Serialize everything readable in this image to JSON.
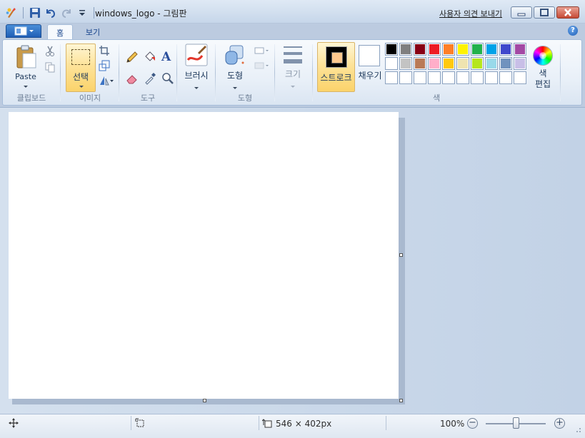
{
  "window": {
    "title": "windows_logo - 그림판",
    "feedback_link": "사용자 의견 보내기"
  },
  "quick_access": {
    "items": [
      "save-icon",
      "undo-icon",
      "redo-icon",
      "customize-icon"
    ]
  },
  "tabs": [
    {
      "label": "홈",
      "selected": true
    },
    {
      "label": "보기",
      "selected": false
    }
  ],
  "ribbon": {
    "clipboard": {
      "paste_label": "Paste",
      "group_label": "클립보드"
    },
    "image": {
      "select_label": "선택",
      "group_label": "이미지"
    },
    "tools": {
      "group_label": "도구"
    },
    "brushes": {
      "label": "브러시"
    },
    "shapes": {
      "label": "도형",
      "group_label": "도형"
    },
    "size": {
      "label": "크기"
    },
    "colors": {
      "stroke_label": "스트로크",
      "fill_label": "채우기",
      "edit_label_1": "색",
      "edit_label_2": "편집",
      "group_label": "색",
      "stroke_color": "#000000",
      "stroke_inner_color": "#ffc98e",
      "fill_color": "#ffffff",
      "palette_row1": [
        "#000000",
        "#7f7f7f",
        "#880015",
        "#ed1c24",
        "#ff7f27",
        "#fff200",
        "#22b14c",
        "#00a2e8",
        "#3f48cc",
        "#a349a4"
      ],
      "palette_row2": [
        "#ffffff",
        "#c3c3c3",
        "#b97a57",
        "#ffaec9",
        "#ffc90e",
        "#efe4b0",
        "#b5e61d",
        "#99d9ea",
        "#7092be",
        "#c8bfe7"
      ],
      "palette_row3": [
        "#ffffff",
        "#ffffff",
        "#ffffff",
        "#ffffff",
        "#ffffff",
        "#ffffff",
        "#ffffff",
        "#ffffff",
        "#ffffff",
        "#ffffff"
      ]
    }
  },
  "status": {
    "image_size": "546 × 402px",
    "zoom": "100%",
    "zoom_level": 1.0
  }
}
